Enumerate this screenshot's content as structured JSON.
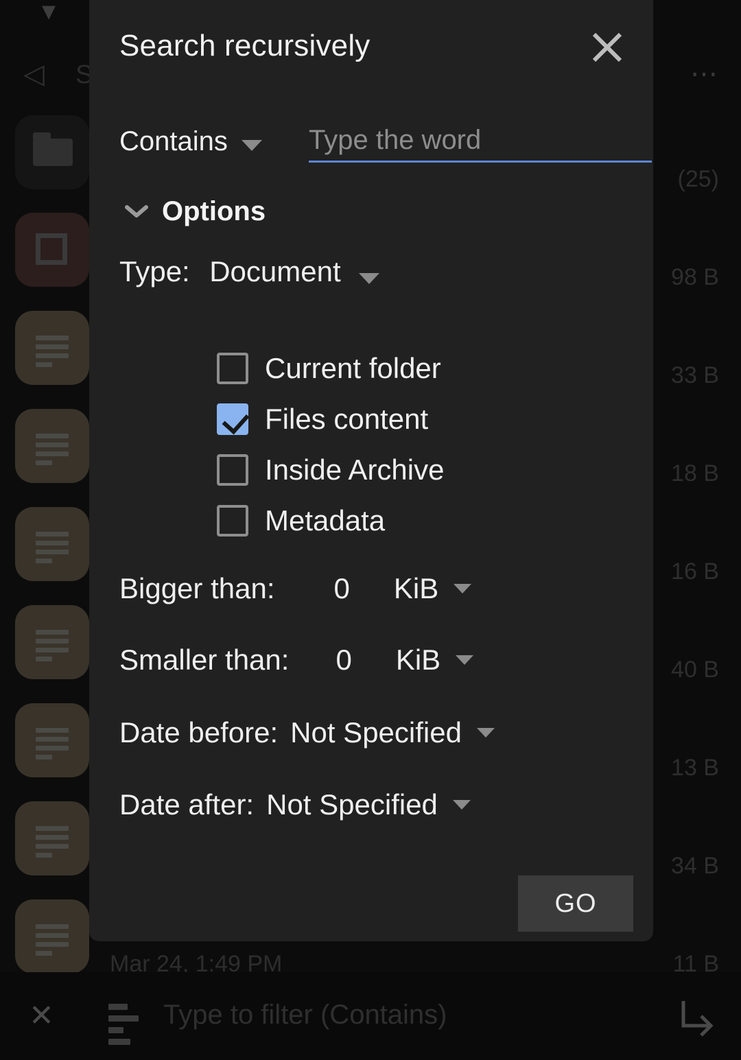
{
  "dialog": {
    "title": "Search recursively",
    "close_icon": "close-icon",
    "contains": {
      "label": "Contains",
      "caret_icon": "chevron-down-icon",
      "input_placeholder": "Type the word",
      "input_value": "",
      "underline_color": "#5e86d6"
    },
    "options": {
      "label": "Options",
      "chevron_icon": "chevron-down-icon"
    },
    "type": {
      "label": "Type:",
      "value": "Document",
      "caret_icon": "chevron-down-icon"
    },
    "checkboxes": [
      {
        "label": "Current folder",
        "checked": false
      },
      {
        "label": "Files content",
        "checked": true
      },
      {
        "label": "Inside Archive",
        "checked": false
      },
      {
        "label": "Metadata",
        "checked": false
      }
    ],
    "checked_color": "#8ab4f0",
    "bigger_than": {
      "label": "Bigger than:",
      "value": "0",
      "unit": "KiB",
      "caret_icon": "chevron-down-icon"
    },
    "smaller_than": {
      "label": "Smaller than:",
      "value": "0",
      "unit": "KiB",
      "caret_icon": "chevron-down-icon"
    },
    "date_before": {
      "label": "Date before:",
      "value": "Not Specified",
      "caret_icon": "chevron-down-icon"
    },
    "date_after": {
      "label": "Date after:",
      "value": "Not Specified",
      "caret_icon": "chevron-down-icon"
    },
    "go_button": "GO"
  },
  "background": {
    "chevron_icon": "chevron-down-icon",
    "back_icon": "back-arrow-icon",
    "title": "S",
    "overflow_icon": "more-options-icon",
    "tiles": [
      {
        "icon": "folder-icon",
        "kind": "folder"
      },
      {
        "icon": "archive-icon",
        "kind": "archive"
      },
      {
        "icon": "document-icon",
        "kind": "doc"
      },
      {
        "icon": "document-icon",
        "kind": "doc"
      },
      {
        "icon": "document-icon",
        "kind": "doc"
      },
      {
        "icon": "document-icon",
        "kind": "doc"
      },
      {
        "icon": "document-icon",
        "kind": "doc"
      },
      {
        "icon": "document-icon",
        "kind": "doc"
      },
      {
        "icon": "document-icon",
        "kind": "doc"
      }
    ],
    "sizes": [
      "(25)",
      "98 B",
      "33 B",
      "18 B",
      "16 B",
      "40 B",
      "13 B",
      "34 B",
      "11 B"
    ],
    "last_row_date": "Mar 24, 1:49 PM"
  },
  "filter_bar": {
    "close_icon": "close-icon",
    "sort_icon": "filter-sort-icon",
    "placeholder": "Type to filter (Contains)",
    "value": "",
    "enter_icon": "enter-arrow-icon"
  }
}
